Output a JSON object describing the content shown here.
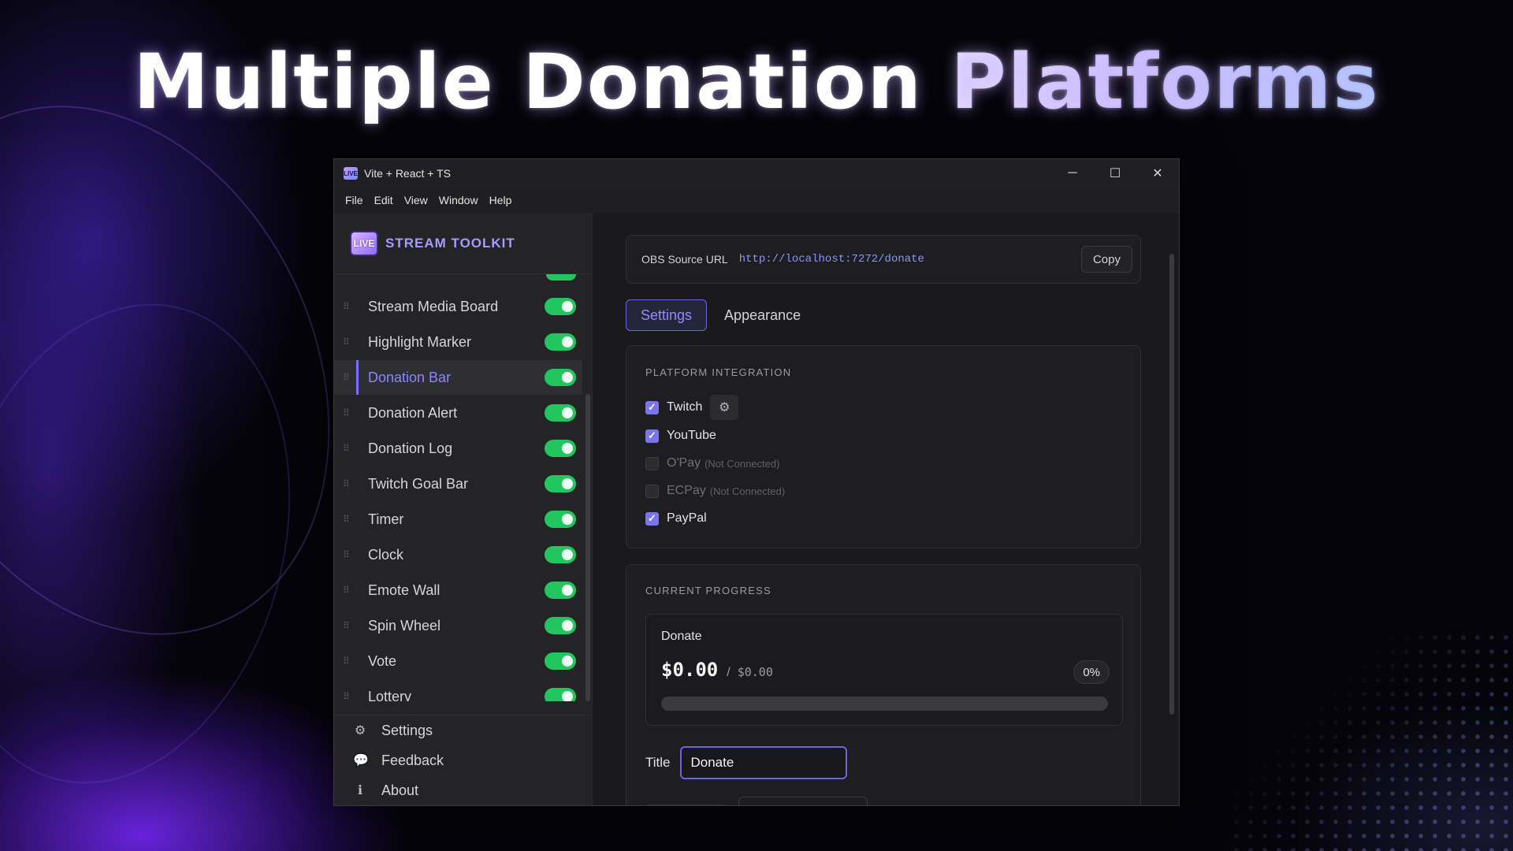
{
  "headline": {
    "part1": "Multiple Donation",
    "part2": "Platforms"
  },
  "window": {
    "title": "Vite + React + TS",
    "app_icon": "LIVE",
    "controls": {
      "minimize": "─",
      "maximize": "☐",
      "close": "✕"
    }
  },
  "menu": [
    "File",
    "Edit",
    "View",
    "Window",
    "Help"
  ],
  "sidebar": {
    "brand_logo": "LIVE",
    "brand": "STREAM TOOLKIT",
    "items": [
      {
        "label": "Stream Media Board",
        "enabled": true
      },
      {
        "label": "Highlight Marker",
        "enabled": true
      },
      {
        "label": "Donation Bar",
        "enabled": true,
        "active": true
      },
      {
        "label": "Donation Alert",
        "enabled": true
      },
      {
        "label": "Donation Log",
        "enabled": true
      },
      {
        "label": "Twitch Goal Bar",
        "enabled": true
      },
      {
        "label": "Timer",
        "enabled": true
      },
      {
        "label": "Clock",
        "enabled": true
      },
      {
        "label": "Emote Wall",
        "enabled": true
      },
      {
        "label": "Spin Wheel",
        "enabled": true
      },
      {
        "label": "Vote",
        "enabled": true
      },
      {
        "label": "Lottery",
        "enabled": true
      }
    ],
    "footer": [
      {
        "label": "Settings",
        "icon": "gear-icon"
      },
      {
        "label": "Feedback",
        "icon": "speech-bubble-icon"
      },
      {
        "label": "About",
        "icon": "info-icon"
      }
    ]
  },
  "main": {
    "obs_url_label": "OBS Source URL",
    "obs_url": "http://localhost:7272/donate",
    "copy_label": "Copy",
    "tabs": [
      {
        "label": "Settings",
        "active": true
      },
      {
        "label": "Appearance",
        "active": false
      }
    ],
    "platform_section": "PLATFORM INTEGRATION",
    "platforms": [
      {
        "name": "Twitch",
        "checked": true,
        "note": "",
        "has_settings": true
      },
      {
        "name": "YouTube",
        "checked": true,
        "note": ""
      },
      {
        "name": "O'Pay",
        "checked": false,
        "note": "(Not Connected)"
      },
      {
        "name": "ECPay",
        "checked": false,
        "note": "(Not Connected)"
      },
      {
        "name": "PayPal",
        "checked": true,
        "note": ""
      }
    ],
    "progress_section": "CURRENT PROGRESS",
    "progress": {
      "title": "Donate",
      "current": "$0.00",
      "separator": "/",
      "goal": "$0.00",
      "percent_label": "0%",
      "fraction": 0
    },
    "title_field": {
      "label": "Title",
      "value": "Donate"
    }
  },
  "colors": {
    "accent": "#7c6cff",
    "toggle_on": "#22c55e",
    "window_bg": "#1c1c1f"
  }
}
